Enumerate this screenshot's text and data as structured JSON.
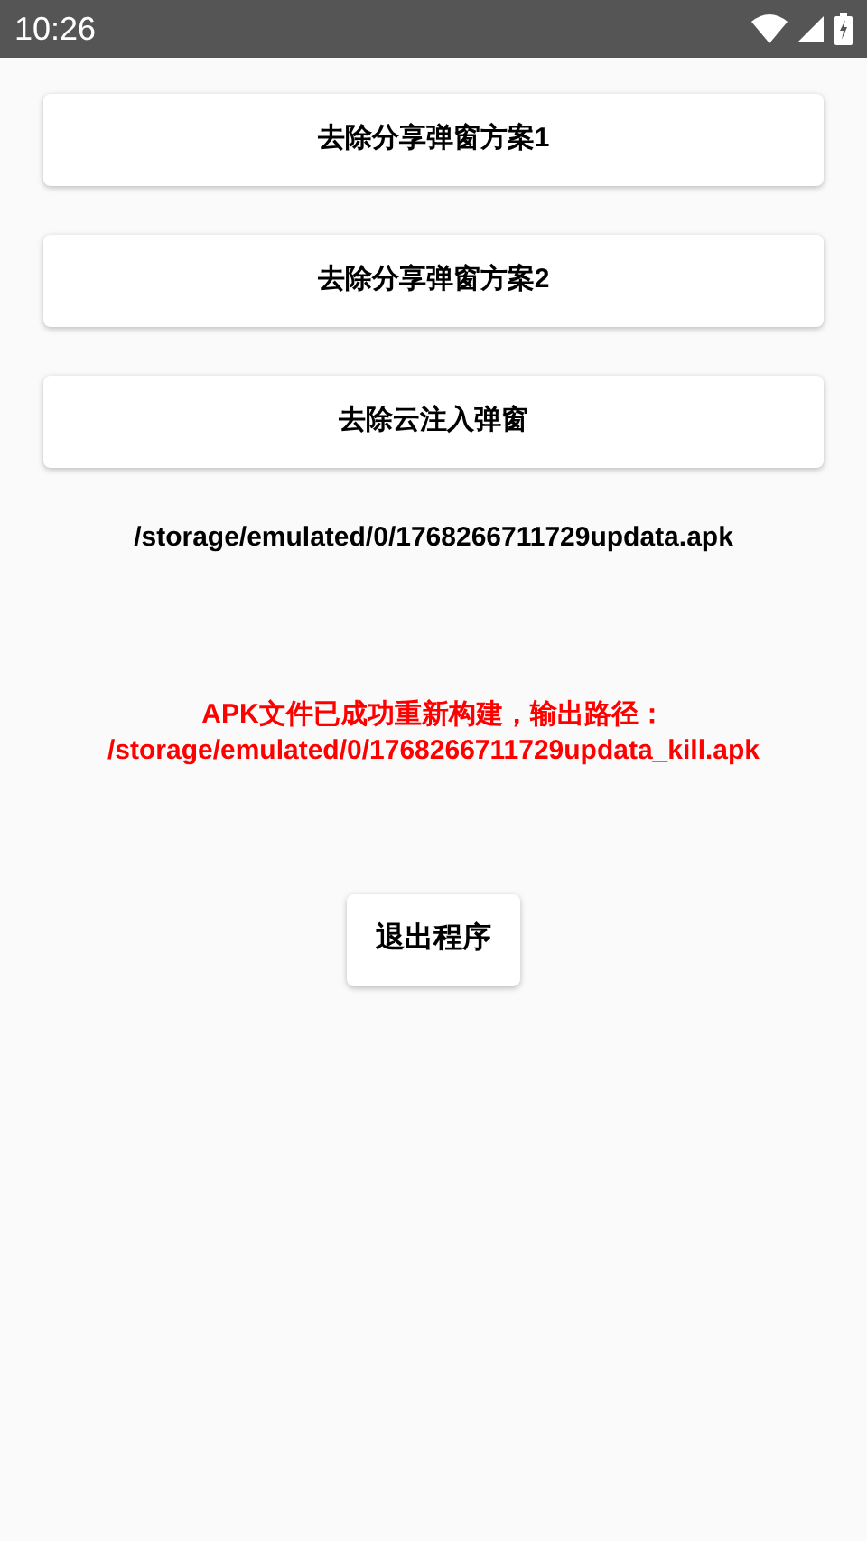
{
  "status_bar": {
    "time": "10:26"
  },
  "buttons": [
    {
      "label": "去除分享弹窗方案1"
    },
    {
      "label": "去除分享弹窗方案2"
    },
    {
      "label": "去除云注入弹窗"
    }
  ],
  "input_path": "/storage/emulated/0/1768266711729updata.apk",
  "result_message": "APK文件已成功重新构建，输出路径：\n/storage/emulated/0/1768266711729updata_kill.apk",
  "exit_button": {
    "label": "退出程序"
  }
}
